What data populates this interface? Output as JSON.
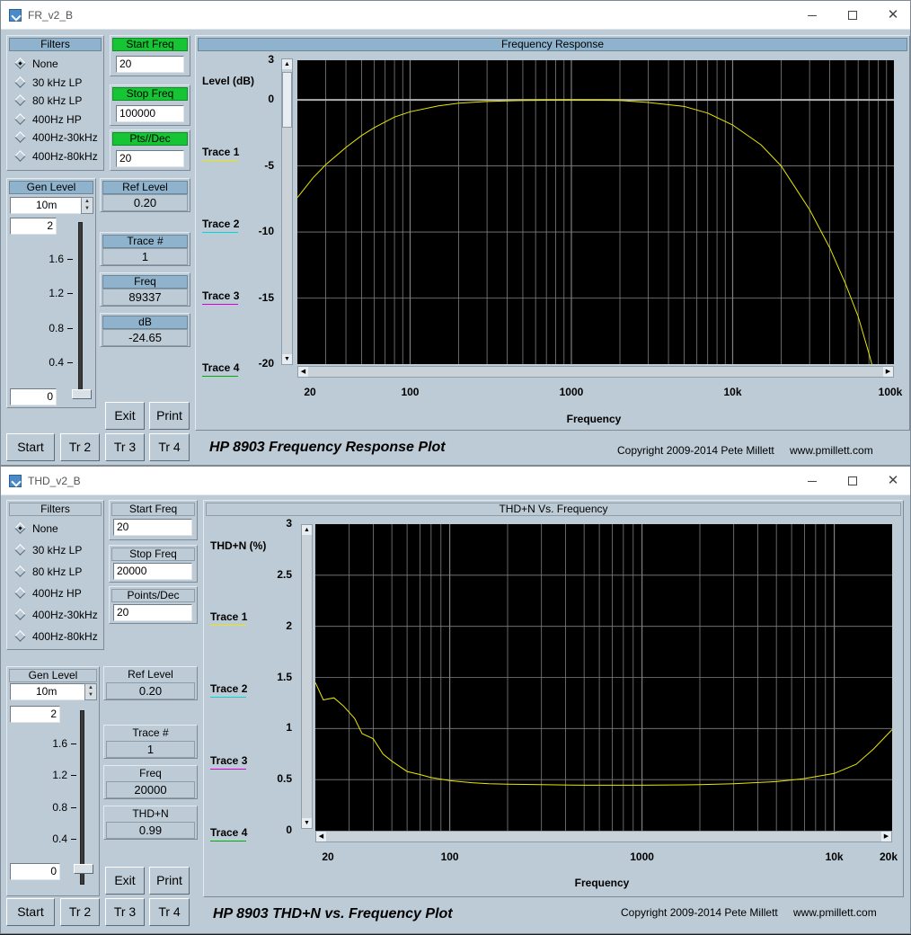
{
  "fr": {
    "window_title": "FR_v2_B",
    "filters_header": "Filters",
    "filters": [
      "None",
      "30 kHz LP",
      "80 kHz LP",
      "400Hz HP",
      "400Hz-30kHz",
      "400Hz-80kHz"
    ],
    "filter_selected": "None",
    "start_freq_label": "Start Freq",
    "start_freq_value": "20",
    "stop_freq_label": "Stop Freq",
    "stop_freq_value": "100000",
    "ptsdec_label": "Pts//Dec",
    "ptsdec_value": "20",
    "gen_level_label": "Gen Level",
    "gen_level_value": "10m",
    "slider_top": "2",
    "slider_ticks": [
      "1.6",
      "1.2",
      "0.8",
      "0.4"
    ],
    "slider_value": "0",
    "ref_level_label": "Ref Level",
    "ref_level_value": "0.20",
    "trace_num_label": "Trace #",
    "trace_num_value": "1",
    "freq_label": "Freq",
    "freq_value": "89337",
    "db_label": "dB",
    "db_value": "-24.65",
    "exit_label": "Exit",
    "print_label": "Print",
    "start_label": "Start",
    "tr2_label": "Tr 2",
    "tr3_label": "Tr 3",
    "tr4_label": "Tr 4",
    "plot_header": "Frequency Response",
    "y_axis_label": "Level (dB)",
    "y_ticks": [
      "3",
      "0",
      "-5",
      "-10",
      "-15",
      "-20"
    ],
    "x_ticks": [
      "20",
      "100",
      "1000",
      "10k",
      "100k"
    ],
    "x_axis_label": "Frequency",
    "traces": [
      "Trace 1",
      "Trace 2",
      "Trace 3",
      "Trace 4"
    ],
    "plot_title": "HP 8903 Frequency Response Plot",
    "copyright": "Copyright 2009-2014 Pete Millett",
    "website": "www.pmillett.com"
  },
  "thd": {
    "window_title": "THD_v2_B",
    "filters_header": "Filters",
    "filters": [
      "None",
      "30 kHz LP",
      "80 kHz LP",
      "400Hz HP",
      "400Hz-30kHz",
      "400Hz-80kHz"
    ],
    "filter_selected": "None",
    "start_freq_label": "Start Freq",
    "start_freq_value": "20",
    "stop_freq_label": "Stop Freq",
    "stop_freq_value": "20000",
    "ptsdec_label": "Points/Dec",
    "ptsdec_value": "20",
    "gen_level_label": "Gen Level",
    "gen_level_value": "10m",
    "slider_top": "2",
    "slider_ticks": [
      "1.6",
      "1.2",
      "0.8",
      "0.4"
    ],
    "slider_value": "0",
    "ref_level_label": "Ref Level",
    "ref_level_value": "0.20",
    "trace_num_label": "Trace #",
    "trace_num_value": "1",
    "freq_label": "Freq",
    "freq_value": "20000",
    "thd_label": "THD+N",
    "thd_value": "0.99",
    "exit_label": "Exit",
    "print_label": "Print",
    "start_label": "Start",
    "tr2_label": "Tr 2",
    "tr3_label": "Tr 3",
    "tr4_label": "Tr 4",
    "plot_header": "THD+N Vs. Frequency",
    "y_axis_label": "THD+N (%)",
    "y_ticks": [
      "3",
      "2.5",
      "2",
      "1.5",
      "1",
      "0.5",
      "0"
    ],
    "x_ticks": [
      "20",
      "100",
      "1000",
      "10k",
      "20k"
    ],
    "x_axis_label": "Frequency",
    "traces": [
      "Trace 1",
      "Trace 2",
      "Trace 3",
      "Trace 4"
    ],
    "plot_title": "HP 8903 THD+N vs. Frequency Plot",
    "copyright": "Copyright 2009-2014 Pete Millett",
    "website": "www.pmillett.com"
  },
  "colors": {
    "trace1": "#e8e800",
    "trace2": "#00d8d8",
    "trace3": "#d800d8",
    "trace4": "#00b000",
    "grid": "#808080"
  },
  "chart_data": [
    {
      "type": "line",
      "title": "Frequency Response",
      "xlabel": "Frequency",
      "ylabel": "Level (dB)",
      "x_scale": "log",
      "xlim": [
        20,
        100000
      ],
      "ylim": [
        -20,
        3
      ],
      "grid": true,
      "series": [
        {
          "name": "Trace 1",
          "x": [
            20,
            25,
            30,
            40,
            50,
            60,
            80,
            100,
            150,
            200,
            300,
            500,
            1000,
            2000,
            3000,
            5000,
            7000,
            10000,
            15000,
            20000,
            30000,
            40000,
            50000,
            60000,
            70000,
            80000,
            89337
          ],
          "y": [
            -7.4,
            -5.9,
            -4.9,
            -3.6,
            -2.7,
            -2.1,
            -1.3,
            -0.9,
            -0.45,
            -0.25,
            -0.12,
            -0.05,
            0,
            -0.05,
            -0.2,
            -0.5,
            -1.0,
            -1.9,
            -3.4,
            -5.0,
            -8.3,
            -11.2,
            -13.9,
            -16.4,
            -19.2,
            -21.8,
            -24.65
          ]
        }
      ]
    },
    {
      "type": "line",
      "title": "THD+N Vs. Frequency",
      "xlabel": "Frequency",
      "ylabel": "THD+N (%)",
      "x_scale": "log",
      "xlim": [
        20,
        20000
      ],
      "ylim": [
        0,
        3
      ],
      "grid": true,
      "series": [
        {
          "name": "Trace 1",
          "x": [
            20,
            22,
            25,
            28,
            32,
            35,
            40,
            45,
            50,
            60,
            70,
            80,
            100,
            130,
            160,
            200,
            300,
            500,
            1000,
            2000,
            3000,
            5000,
            7000,
            10000,
            13000,
            16000,
            20000
          ],
          "y": [
            1.45,
            1.28,
            1.3,
            1.22,
            1.1,
            0.95,
            0.9,
            0.75,
            0.68,
            0.58,
            0.55,
            0.52,
            0.49,
            0.47,
            0.46,
            0.455,
            0.45,
            0.445,
            0.445,
            0.45,
            0.46,
            0.48,
            0.51,
            0.56,
            0.65,
            0.8,
            0.99
          ]
        }
      ]
    }
  ]
}
